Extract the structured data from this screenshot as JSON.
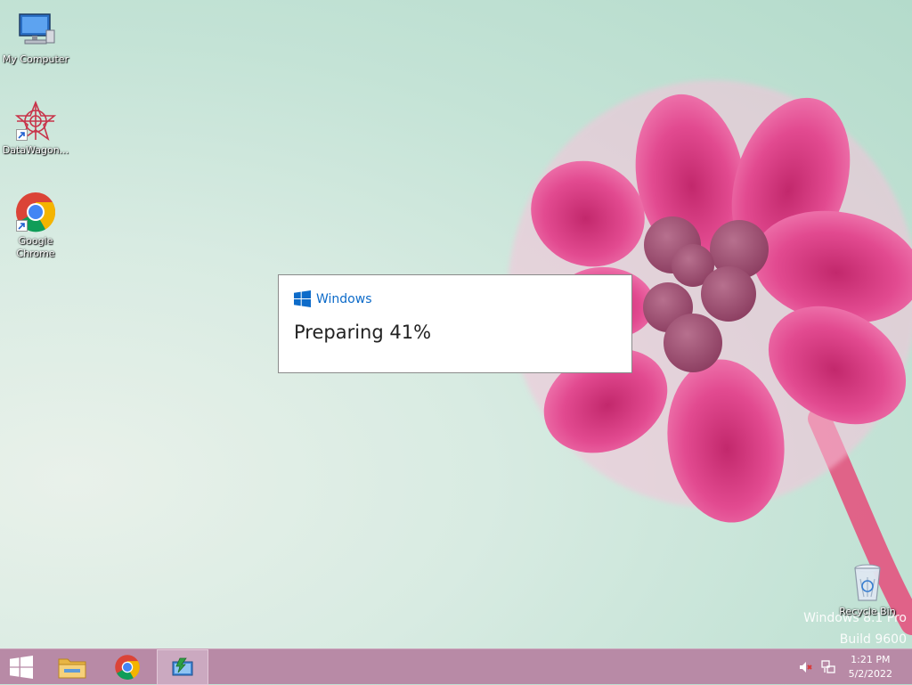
{
  "desktop": {
    "icons": [
      {
        "label": "My Computer",
        "icon": "computer-icon"
      },
      {
        "label": "DataWagon...",
        "icon": "datawagon-icon"
      },
      {
        "label": "Google Chrome",
        "icon": "chrome-icon"
      },
      {
        "label": "Recycle Bin",
        "icon": "recycle-bin-icon"
      }
    ],
    "watermark": {
      "line1": "Windows 8.1 Pro",
      "line2": "Build 9600"
    }
  },
  "dialog": {
    "brand": "Windows",
    "status": "Preparing 41%",
    "progress_percent": 41
  },
  "taskbar": {
    "start": "windows-logo-icon",
    "pinned": [
      "file-explorer-icon",
      "chrome-icon",
      "installer-icon"
    ],
    "active": "installer-icon",
    "tray": [
      "muted-speaker-icon",
      "network-icon"
    ],
    "clock": {
      "time": "1:21 PM",
      "date": "5/2/2022"
    }
  },
  "colors": {
    "accent": "#0d6bc9",
    "taskbar": "#b88aa6",
    "flower": "#e0458c"
  }
}
